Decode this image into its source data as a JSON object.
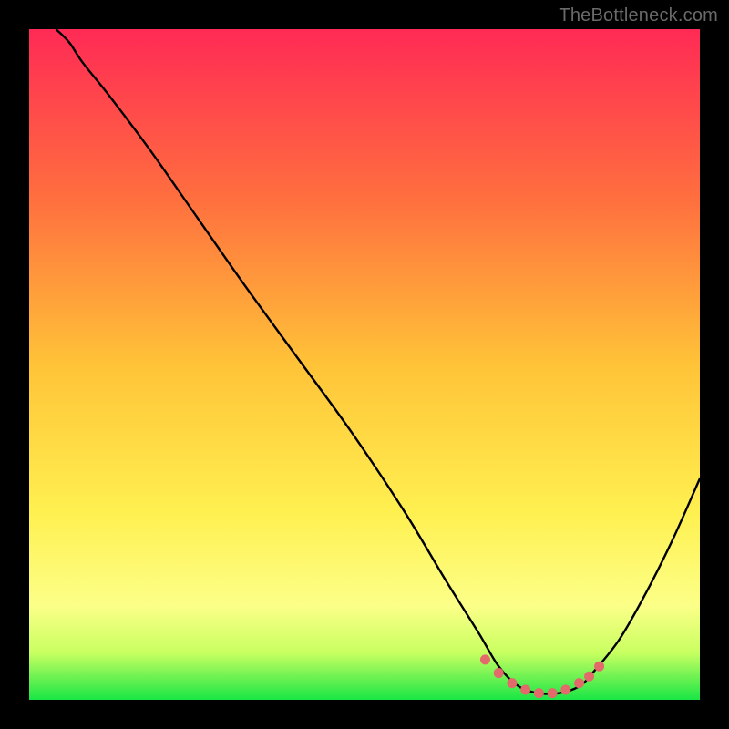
{
  "attribution": "TheBottleneck.com",
  "chart_data": {
    "type": "line",
    "title": "",
    "xlabel": "",
    "ylabel": "",
    "xlim": [
      0,
      100
    ],
    "ylim": [
      0,
      100
    ],
    "background_gradient": {
      "stops": [
        {
          "offset": 0,
          "color": "#ff2a55"
        },
        {
          "offset": 25,
          "color": "#ff6e3f"
        },
        {
          "offset": 50,
          "color": "#ffc338"
        },
        {
          "offset": 72,
          "color": "#fff050"
        },
        {
          "offset": 86,
          "color": "#fcff88"
        },
        {
          "offset": 93,
          "color": "#c8ff60"
        },
        {
          "offset": 100,
          "color": "#19e646"
        }
      ]
    },
    "series": [
      {
        "name": "bottleneck-curve",
        "color": "#000000",
        "x": [
          4,
          6,
          8,
          12,
          18,
          25,
          32,
          40,
          48,
          56,
          62,
          67,
          70,
          73,
          76,
          79,
          82,
          84,
          88,
          92,
          96,
          100
        ],
        "y": [
          100,
          98,
          95,
          90,
          82,
          72,
          62,
          51,
          40,
          28,
          18,
          10,
          5,
          2,
          1,
          1,
          2,
          4,
          9,
          16,
          24,
          33
        ]
      }
    ],
    "markers": {
      "name": "min-region",
      "color": "#e36a6a",
      "points": [
        {
          "x": 68,
          "y": 6
        },
        {
          "x": 70,
          "y": 4
        },
        {
          "x": 72,
          "y": 2.5
        },
        {
          "x": 74,
          "y": 1.5
        },
        {
          "x": 76,
          "y": 1
        },
        {
          "x": 78,
          "y": 1
        },
        {
          "x": 80,
          "y": 1.5
        },
        {
          "x": 82,
          "y": 2.5
        },
        {
          "x": 83.5,
          "y": 3.5
        },
        {
          "x": 85,
          "y": 5
        }
      ]
    }
  }
}
